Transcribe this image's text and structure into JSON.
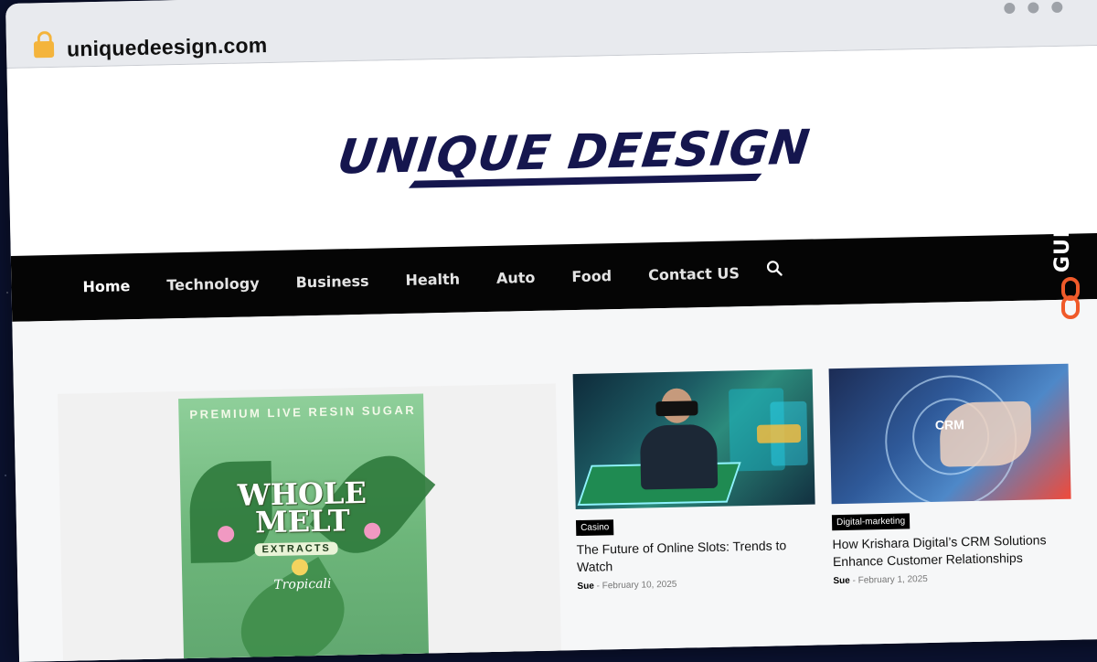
{
  "browser": {
    "url": "uniquedeesign.com"
  },
  "site": {
    "logo_text": "UNIQUE DEESIGN"
  },
  "nav": {
    "items": [
      {
        "label": "Home",
        "active": true
      },
      {
        "label": "Technology"
      },
      {
        "label": "Business"
      },
      {
        "label": "Health"
      },
      {
        "label": "Auto"
      },
      {
        "label": "Food"
      },
      {
        "label": "Contact US"
      }
    ]
  },
  "hero": {
    "pack_top": "PREMIUM LIVE RESIN SUGAR",
    "pack_brand": "WHOLE MELT",
    "pack_sub": "EXTRACTS",
    "pack_script": "Tropicali"
  },
  "cards": [
    {
      "category": "Casino",
      "title": "The Future of Online Slots: Trends to Watch",
      "author": "Sue",
      "date": "February 10, 2025"
    },
    {
      "category": "Digital-marketing",
      "title": "How Krishara Digital’s CRM Solutions Enhance Customer Relationships",
      "author": "Sue",
      "date": "February 1, 2025",
      "image_label": "CRM"
    }
  ],
  "watermark": {
    "text": "GUESTPOSTLINKS"
  },
  "colors": {
    "nav_bg": "#050505",
    "logo": "#15164e",
    "watermark_accent": "#f05a2a"
  }
}
